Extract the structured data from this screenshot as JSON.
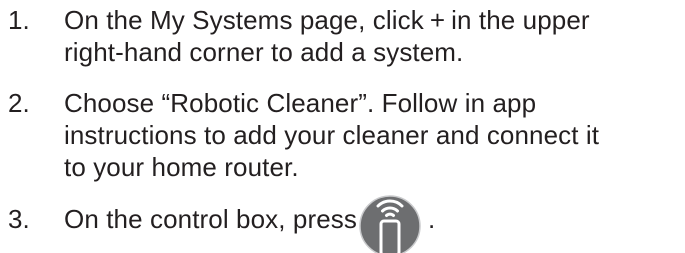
{
  "steps": [
    {
      "number": "1.",
      "lines": [
        "On the My Systems page, click",
        "+",
        "in the upper",
        "right-hand corner to add a system."
      ]
    },
    {
      "number": "2.",
      "lines": [
        "Choose “Robotic Cleaner”. Follow in app",
        "instructions to add your cleaner and connect it",
        "to your home router."
      ]
    },
    {
      "number": "3.",
      "lines": [
        "On the control box, press",
        "."
      ]
    }
  ],
  "icons": {
    "control_icon": "wifi-remote-icon",
    "color": "#6d6e70"
  }
}
